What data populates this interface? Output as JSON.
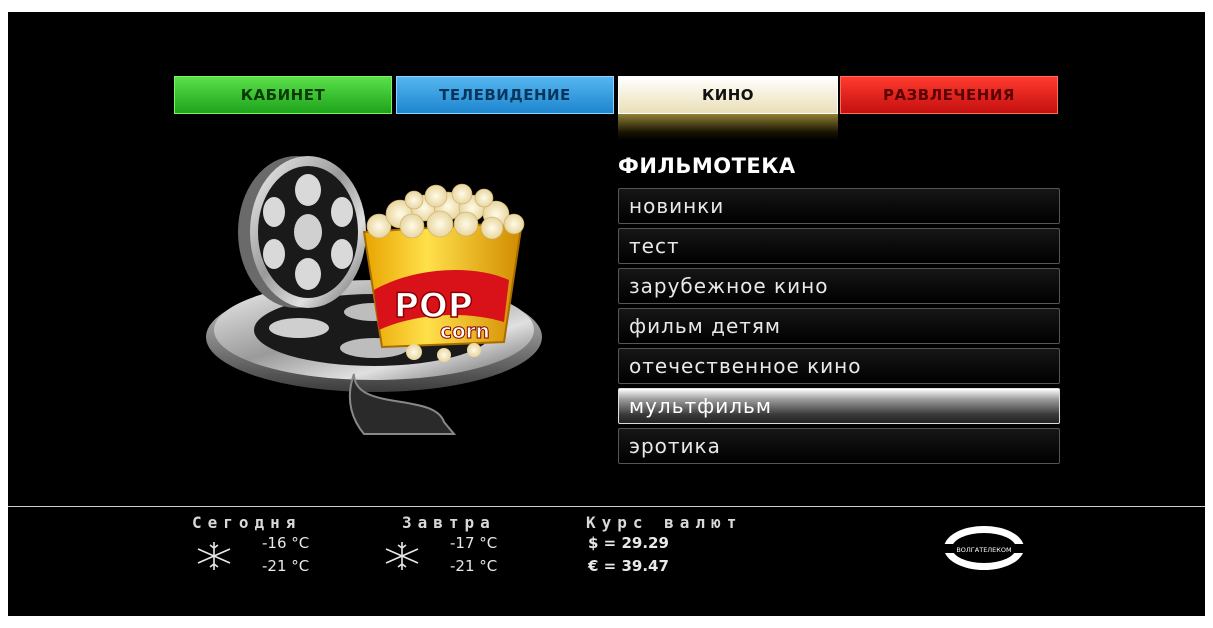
{
  "tabs": [
    {
      "label": "КАБИНЕТ",
      "color": "#27b020"
    },
    {
      "label": "ТЕЛЕВИДЕНИЕ",
      "color": "#2a90d8"
    },
    {
      "label": "КИНО",
      "color": "#f4eed8",
      "active": true
    },
    {
      "label": "РАЗВЛЕЧЕНИЯ",
      "color": "#e01a14"
    }
  ],
  "section_title": "ФИЛЬМОТЕКА",
  "menu": {
    "items": [
      "новинки",
      "тест",
      "зарубежное кино",
      "фильм детям",
      "отечественное кино",
      "мультфильм",
      "эротика"
    ],
    "selected": "мультфильм"
  },
  "illustration": {
    "popcorn_text_top": "POP",
    "popcorn_text_bottom": "corn"
  },
  "weather": {
    "today": {
      "label": "Сегодня",
      "high": "-16 °C",
      "low": "-21 °C",
      "icon": "snowflake-icon"
    },
    "tomorrow": {
      "label": "Завтра",
      "high": "-17 °C",
      "low": "-21 °C",
      "icon": "snowflake-icon"
    }
  },
  "currency": {
    "label": "Курс валют",
    "usd": "$ = 29.29",
    "eur": "€ = 39.47"
  },
  "logo": {
    "text": "ВОЛГАТЕЛЕКОМ"
  }
}
